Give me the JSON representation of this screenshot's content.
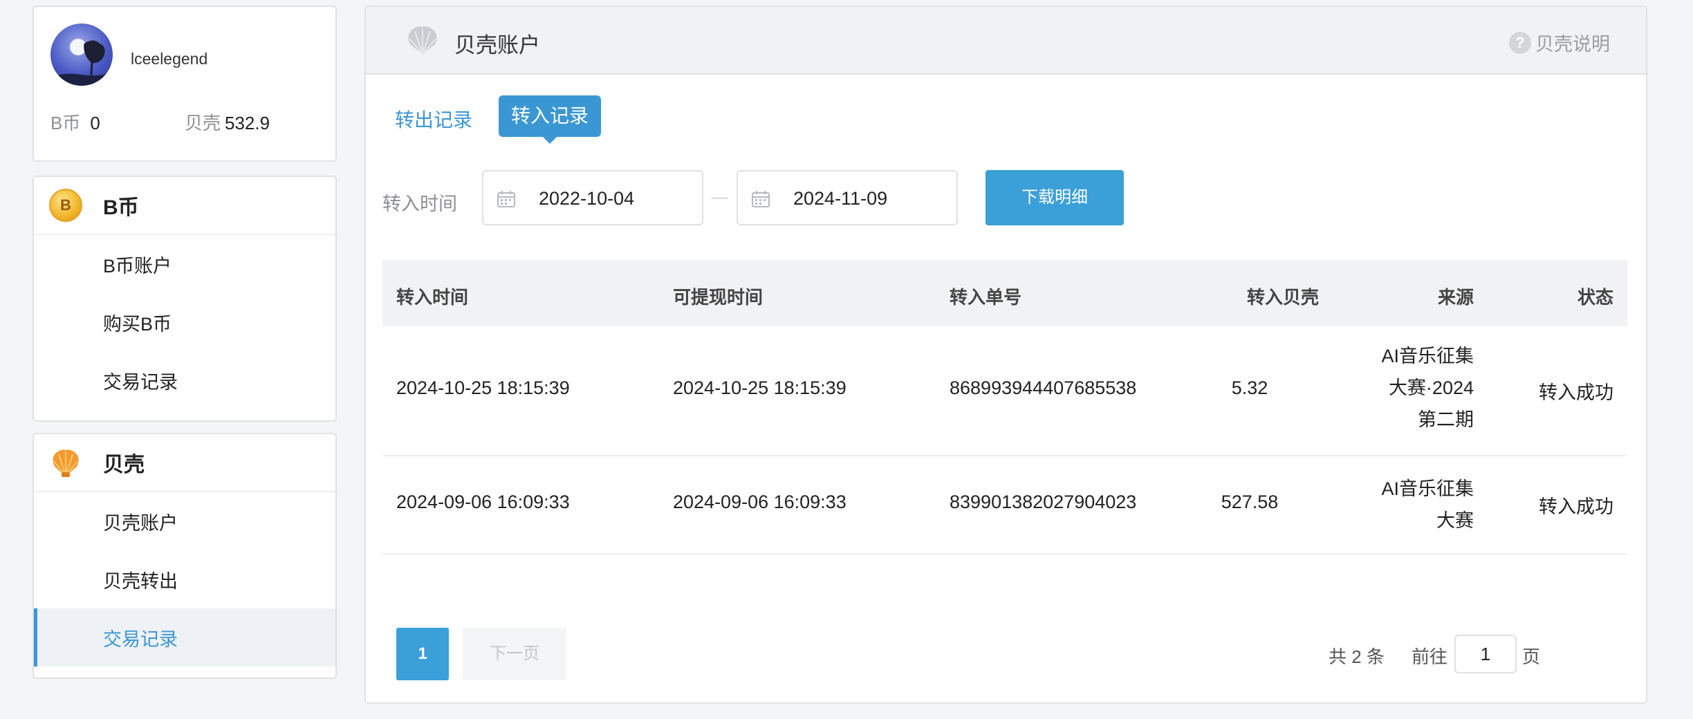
{
  "profile": {
    "username": "lceelegend",
    "bcoin_label": "B币",
    "bcoin_value": "0",
    "shell_label": "贝壳",
    "shell_value": "532.9"
  },
  "bcoin_menu": {
    "title": "B币",
    "icon": "coin-icon",
    "icon_glyph": "B",
    "items": [
      "B币账户",
      "购买B币",
      "交易记录"
    ]
  },
  "shell_menu": {
    "title": "贝壳",
    "icon": "shell-icon",
    "items": [
      "贝壳账户",
      "贝壳转出",
      "交易记录"
    ],
    "active_index": 2
  },
  "main": {
    "title": "贝壳账户",
    "help_label": "贝壳说明",
    "help_glyph": "?",
    "tabs": [
      {
        "label": "转出记录",
        "active": false
      },
      {
        "label": "转入记录",
        "active": true
      }
    ],
    "filter": {
      "label": "转入时间",
      "date_from": "2022-10-04",
      "date_to": "2024-11-09",
      "separator": "—",
      "download_label": "下载明细"
    },
    "table": {
      "headers": [
        "转入时间",
        "可提现时间",
        "转入单号",
        "转入贝壳",
        "来源",
        "状态"
      ],
      "rows": [
        {
          "time": "2024-10-25 18:15:39",
          "withdraw_time": "2024-10-25 18:15:39",
          "order_no": "868993944407685538",
          "amount": "5.32",
          "source": [
            "AI音乐征集",
            "大赛·2024",
            "第二期"
          ],
          "status": "转入成功"
        },
        {
          "time": "2024-09-06 16:09:33",
          "withdraw_time": "2024-09-06 16:09:33",
          "order_no": "839901382027904023",
          "amount": "527.58",
          "source": [
            "AI音乐征集",
            "大赛"
          ],
          "status": "转入成功"
        }
      ]
    },
    "pagination": {
      "current_page": "1",
      "next_label": "下一页",
      "total_text": "共 2 条",
      "goto_label": "前往",
      "goto_value": "1",
      "page_suffix": "页"
    }
  },
  "colors": {
    "accent": "#3b97d3",
    "button": "#3b9fd8",
    "coin": "#f0b429",
    "shell": "#f29a2e"
  }
}
